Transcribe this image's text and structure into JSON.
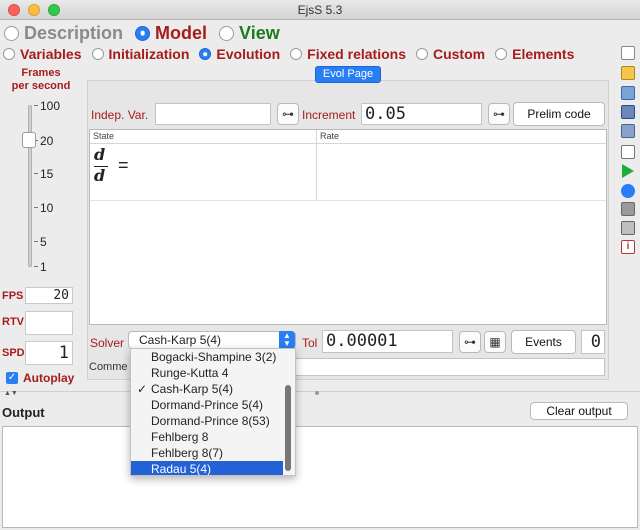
{
  "window": {
    "title": "EjsS 5.3"
  },
  "top_tabs": [
    {
      "label": "Description",
      "selected": false
    },
    {
      "label": "Model",
      "selected": true
    },
    {
      "label": "View",
      "selected": false
    }
  ],
  "sub_tabs": [
    {
      "label": "Variables",
      "selected": false
    },
    {
      "label": "Initialization",
      "selected": false
    },
    {
      "label": "Evolution",
      "selected": true
    },
    {
      "label": "Fixed relations",
      "selected": false
    },
    {
      "label": "Custom",
      "selected": false
    },
    {
      "label": "Elements",
      "selected": false
    }
  ],
  "speed": {
    "title_line1": "Frames",
    "title_line2": "per second",
    "ticks": [
      "100",
      "20",
      "15",
      "10",
      "5",
      "1"
    ],
    "fps_label": "FPS",
    "fps_value": "20",
    "rtv_label": "RTV",
    "rtv_value": "",
    "spd_label": "SPD",
    "spd_value": "1",
    "autoplay_label": "Autoplay",
    "autoplay_checked": true
  },
  "evol": {
    "page_tab": "Evol Page",
    "indep_var_label": "Indep. Var.",
    "indep_var_value": "",
    "increment_label": "Increment",
    "increment_value": "0.05",
    "prelim_button": "Prelim code",
    "table_headers": {
      "state": "State",
      "rate": "Rate"
    },
    "equation": {
      "num": "d",
      "den": "d",
      "eq": "="
    },
    "solver_label": "Solver",
    "solver_value": "Cash-Karp 5(4)",
    "tol_label": "Tol",
    "tol_value": "0.00001",
    "events_button": "Events",
    "events_count": "0",
    "comment_label": "Comme"
  },
  "solver_options": [
    {
      "label": "Bogacki-Shampine 3(2)",
      "checked": false,
      "highlighted": false
    },
    {
      "label": "Runge-Kutta 4",
      "checked": false,
      "highlighted": false
    },
    {
      "label": "Cash-Karp 5(4)",
      "checked": true,
      "highlighted": false
    },
    {
      "label": "Dormand-Prince 5(4)",
      "checked": false,
      "highlighted": false
    },
    {
      "label": "Dormand-Prince 8(53)",
      "checked": false,
      "highlighted": false
    },
    {
      "label": "Fehlberg 8",
      "checked": false,
      "highlighted": false
    },
    {
      "label": "Fehlberg 8(7)",
      "checked": false,
      "highlighted": false
    },
    {
      "label": "Radau 5(4)",
      "checked": false,
      "highlighted": true
    }
  ],
  "output": {
    "label": "Output",
    "clear_button": "Clear output",
    "text": ""
  },
  "colors": {
    "accent": "#2a7ef5",
    "tab_red": "#a51c1c",
    "highlight": "#2361d7"
  },
  "toolbar_icons": [
    "new-file-icon",
    "open-folder-icon",
    "browse-icon",
    "save-icon",
    "save-as-icon",
    "search-icon",
    "run-icon",
    "refresh-icon",
    "package-icon",
    "print-icon",
    "info-icon"
  ]
}
